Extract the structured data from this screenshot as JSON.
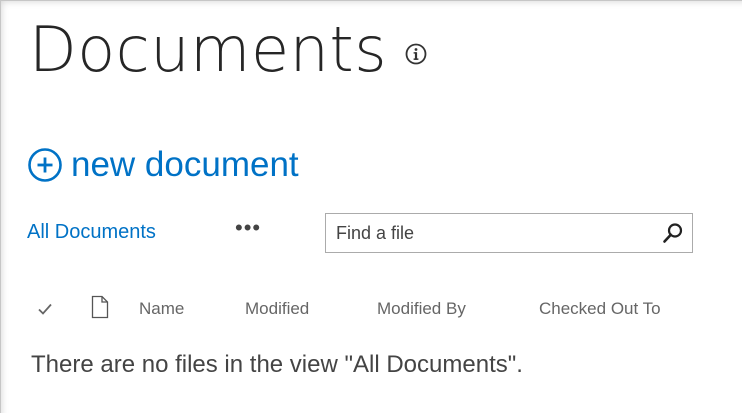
{
  "page": {
    "title": "Documents"
  },
  "toolbar": {
    "new_document_label": "new document"
  },
  "views": {
    "current": "All Documents",
    "more": "•••"
  },
  "search": {
    "placeholder": "Find a file"
  },
  "columns": [
    "Name",
    "Modified",
    "Modified By",
    "Checked Out To"
  ],
  "empty_message": "There are no files in the view \"All Documents\".",
  "colors": {
    "link": "#0072c6",
    "title": "#262626",
    "text": "#444444"
  },
  "icons": [
    "info-icon",
    "add-circle-icon",
    "search-icon",
    "checkmark-icon",
    "document-icon"
  ]
}
